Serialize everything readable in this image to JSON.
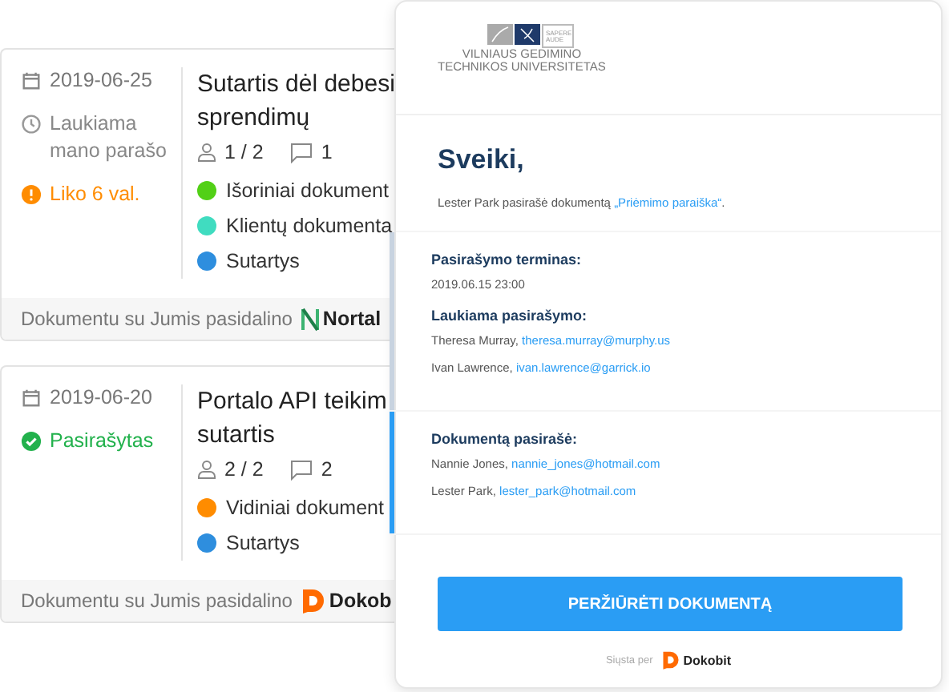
{
  "cards": [
    {
      "date": "2019-06-25",
      "statuses": [
        {
          "kind": "waiting",
          "text": "Laukiama mano parašo"
        },
        {
          "kind": "warning",
          "text": "Liko 6 val."
        }
      ],
      "title_lines": [
        "Sutartis dėl debesi",
        "sprendimų"
      ],
      "signers": "1 / 2",
      "comments": "1",
      "tags": [
        {
          "label": "Išoriniai dokument",
          "color": "#52d016"
        },
        {
          "label": "Klientų dokumenta",
          "color": "#40dcc0"
        },
        {
          "label": "Sutartys",
          "color": "#2e8ede"
        }
      ],
      "shared_by": "Dokumentu su Jumis pasidalino",
      "company": {
        "kind": "nortal",
        "name": "Nortal"
      }
    },
    {
      "date": "2019-06-20",
      "statuses": [
        {
          "kind": "signed",
          "text": "Pasirašytas"
        }
      ],
      "title_lines": [
        "Portalo API teikim",
        "sutartis"
      ],
      "signers": "2 / 2",
      "comments": "2",
      "tags": [
        {
          "label": "Vidiniai dokument",
          "color": "#ff8c00"
        },
        {
          "label": "Sutartys",
          "color": "#2e8ede"
        }
      ],
      "shared_by": "Dokumentu su Jumis pasidalino",
      "company": {
        "kind": "dokobit",
        "name": "Dokob"
      }
    }
  ],
  "email": {
    "logo": {
      "motto": "SAPERE AUDE",
      "lines": [
        "VILNIAUS GEDIMINO",
        "TECHNIKOS UNIVERSITETAS"
      ]
    },
    "greeting": "Sveiki,",
    "message": {
      "before": "Lester Park pasirašė dokumentą ",
      "link": "„Priėmimo paraiška“",
      "after": "."
    },
    "sections": [
      {
        "highlighted": false,
        "blocks": [
          {
            "label": "Pasirašymo terminas:",
            "lines": [
              {
                "text": "2019.06.15 23:00"
              }
            ]
          },
          {
            "label": "Laukiama pasirašymo:",
            "lines": [
              {
                "text": "Theresa Murray, ",
                "email": "theresa.murray@murphy.us"
              },
              {
                "text": "Ivan Lawrence, ",
                "email": "ivan.lawrence@garrick.io"
              }
            ]
          }
        ]
      },
      {
        "highlighted": true,
        "blocks": [
          {
            "label": "Dokumentą pasirašė:",
            "lines": [
              {
                "text": "Nannie Jones, ",
                "email": "nannie_jones@hotmail.com"
              },
              {
                "text": "Lester Park, ",
                "email": "lester_park@hotmail.com"
              }
            ]
          }
        ]
      }
    ],
    "button": "PERŽIŪRĖTI DOKUMENTĄ",
    "sent_via": "Siųsta per",
    "sender_logo": "Dokobit"
  }
}
